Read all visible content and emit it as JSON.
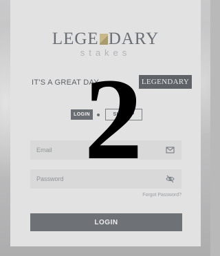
{
  "brand": {
    "name_part1": "LEGE",
    "name_part2": "DARY",
    "subtitle": "stakes"
  },
  "tagline": {
    "text": "IT'S A GREAT DAY",
    "chip": "LEGENDARY"
  },
  "tabs": [
    {
      "label": "LOGIN"
    },
    {
      "label": "SIGN UP"
    }
  ],
  "form": {
    "email_placeholder": "Email",
    "password_placeholder": "Password",
    "forgot_label": "Forgot Password?",
    "submit_label": "LOGIN"
  },
  "overlay": {
    "number": "2"
  },
  "icons": {
    "email": "envelope-icon",
    "password": "eye-slash-icon"
  },
  "colors": {
    "button": "#6e7277",
    "panel": "#e2e2e3",
    "accent_gold": "#c8b888"
  }
}
